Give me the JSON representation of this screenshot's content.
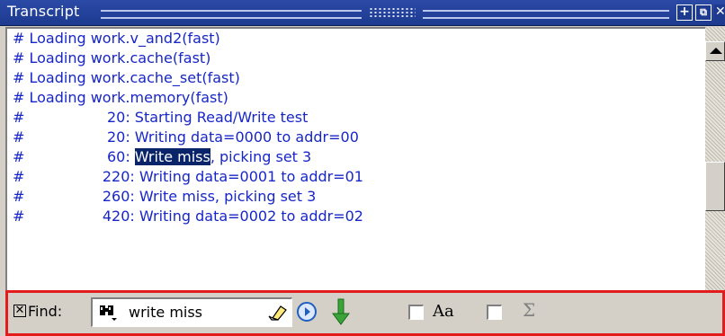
{
  "window": {
    "title": "Transcript"
  },
  "transcript": {
    "lines": [
      {
        "text": "# Loading work.v_and2(fast)"
      },
      {
        "text": "# Loading work.cache(fast)"
      },
      {
        "text": "# Loading work.cache_set(fast)"
      },
      {
        "text": "# Loading work.memory(fast)"
      },
      {
        "text": "#                  20: Starting Read/Write test"
      },
      {
        "text": "#                  20: Writing data=0000 to addr=00"
      },
      {
        "before": "#                  60: ",
        "highlight": "Write miss",
        "after": ", picking set 3"
      },
      {
        "text": "#                 220: Writing data=0001 to addr=01"
      },
      {
        "text": "#                 260: Write miss, picking set 3"
      },
      {
        "text": "#                 420: Writing data=0002 to addr=02"
      }
    ]
  },
  "findbar": {
    "label": "Find:",
    "search_value": "write miss",
    "match_case_label": "Aa",
    "regex_label": "Σ"
  },
  "colors": {
    "text": "#1726c8",
    "titlebar": "#1d3a8f",
    "highlight": "#0a246a",
    "findbar_border": "#e21c1c"
  },
  "icons": [
    "plus-icon",
    "undock-icon",
    "close-icon",
    "binoculars-icon",
    "eraser-icon",
    "find-next-icon",
    "search-down-icon",
    "scroll-up-icon",
    "scroll-down-icon"
  ]
}
